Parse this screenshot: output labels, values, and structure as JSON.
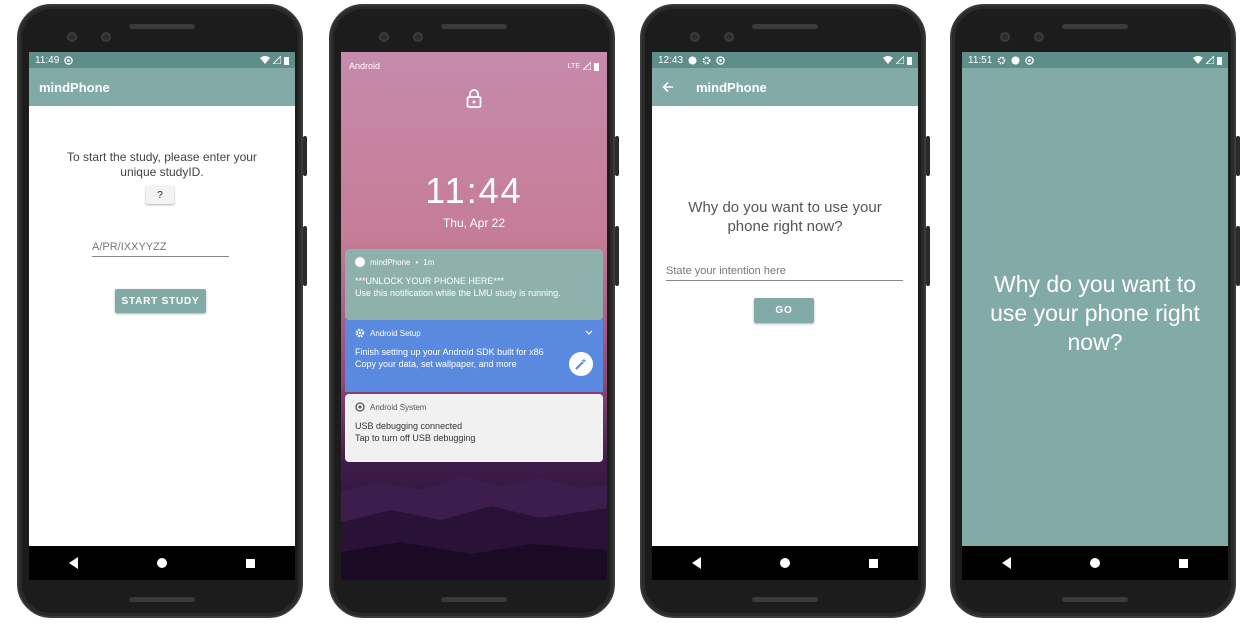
{
  "app_name": "mindPhone",
  "colors": {
    "appbar": "#82aaa7",
    "statusbar": "#5f8d89",
    "button": "#82aaa7",
    "setup_notification": "#5a8ae0"
  },
  "phone1": {
    "status_time": "11:49",
    "instruction_line1": "To start the study, please enter your",
    "instruction_line2": "unique studyID.",
    "help_button": "?",
    "study_id_placeholder": "A/PR/IXXYYZZ",
    "start_button": "START STUDY"
  },
  "phone2": {
    "carrier": "Android",
    "network": "LTE",
    "clock": "11:44",
    "date": "Thu, Apr 22",
    "notifications": [
      {
        "app": "mindPhone",
        "time": "1m",
        "title": "***UNLOCK YOUR PHONE HERE***",
        "body": "Use this notification while the LMU study is running."
      },
      {
        "app": "Android Setup",
        "title": "Finish setting up your Android SDK built for x86",
        "body": "Copy your data, set wallpaper, and more"
      },
      {
        "app": "Android System",
        "title": "USB debugging connected",
        "body": "Tap to turn off USB debugging"
      }
    ]
  },
  "phone3": {
    "status_time": "12:43",
    "question_line1": "Why do you want to use your",
    "question_line2": "phone right now?",
    "intention_placeholder": "State your intention here",
    "go_button": "GO"
  },
  "phone4": {
    "status_time": "11:51",
    "question_line1": "Why do you want to",
    "question_line2": "use your phone right",
    "question_line3": "now?"
  }
}
